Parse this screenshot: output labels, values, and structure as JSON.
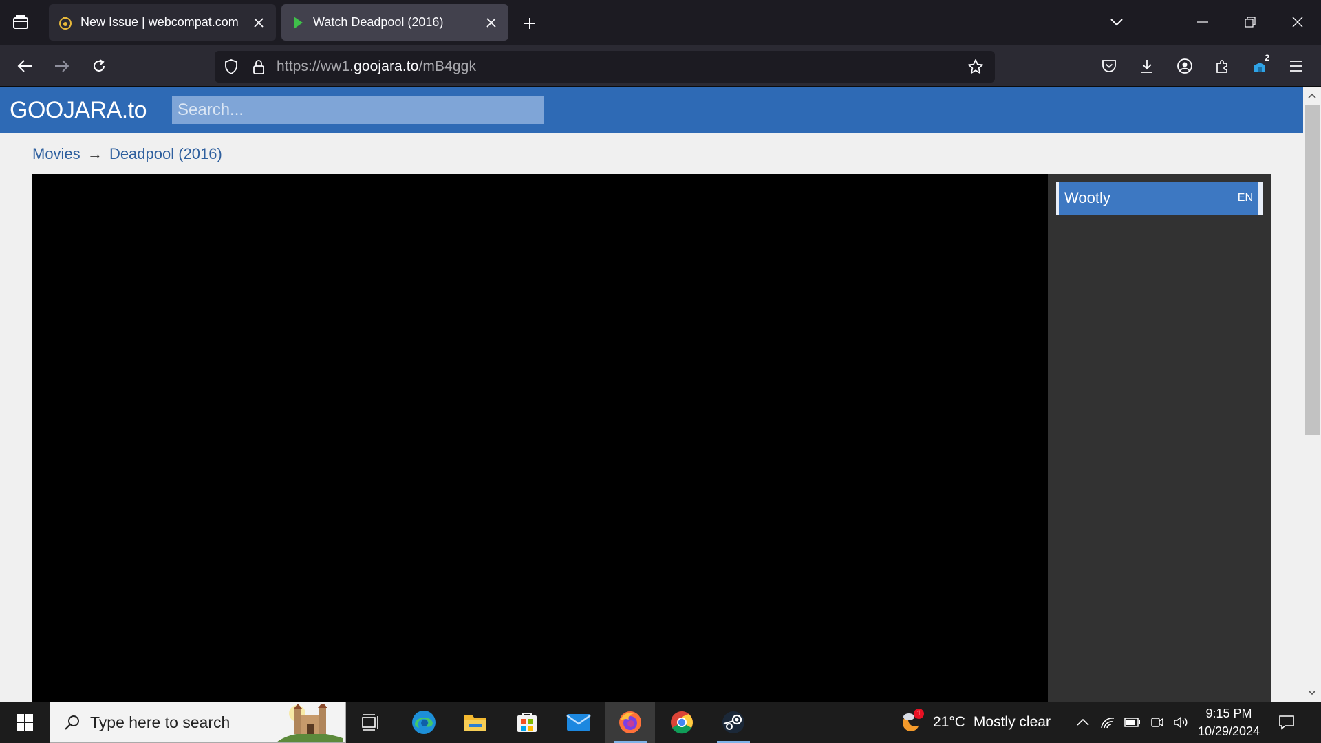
{
  "browser": {
    "tabs": [
      {
        "title": "New Issue | webcompat.com",
        "active": false
      },
      {
        "title": "Watch Deadpool (2016)",
        "active": true
      }
    ],
    "url": {
      "prefix": "https://ww1.",
      "host": "goojara.to",
      "path": "/mB4ggk"
    },
    "extension_badge": "2",
    "icons": [
      "tab-list-icon",
      "new-tab-icon",
      "minimize-icon",
      "restore-icon",
      "close-window-icon",
      "back-icon",
      "forward-icon",
      "reload-icon",
      "shield-icon",
      "lock-icon",
      "bookmark-star-icon",
      "pocket-icon",
      "download-icon",
      "account-icon",
      "extensions-icon",
      "menu-icon"
    ]
  },
  "site": {
    "logo": "GOOJARA.to",
    "search_placeholder": "Search...",
    "breadcrumb": {
      "movies": "Movies",
      "separator": "→",
      "current": "Deadpool (2016)"
    },
    "servers": [
      {
        "name": "Wootly",
        "lang": "EN"
      }
    ]
  },
  "taskbar": {
    "search_placeholder": "Type here to search",
    "weather": {
      "temp": "21°C",
      "desc": "Mostly clear",
      "badge": "1"
    },
    "clock": {
      "time": "9:15 PM",
      "date": "10/29/2024"
    }
  },
  "colors": {
    "site_header": "#2e6ab5",
    "server_item": "#3d78c2",
    "browser_chrome": "#2b2a33",
    "taskbar": "#1c1c1c"
  }
}
